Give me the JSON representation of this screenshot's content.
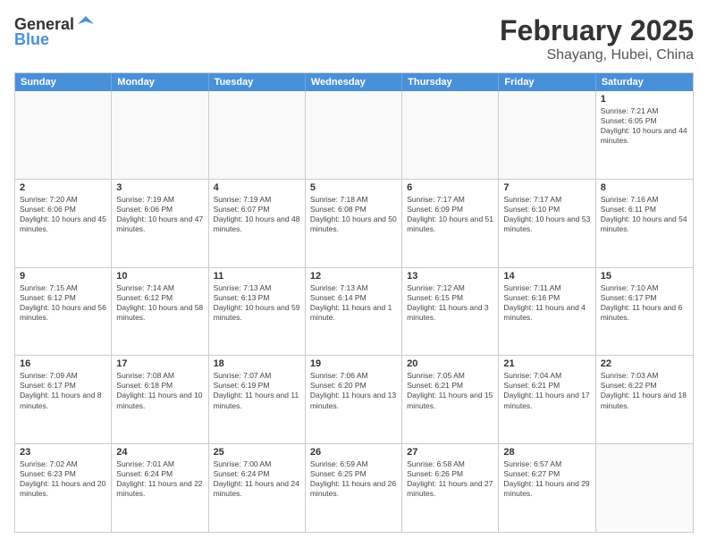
{
  "header": {
    "logo_general": "General",
    "logo_blue": "Blue",
    "month": "February 2025",
    "location": "Shayang, Hubei, China"
  },
  "days_of_week": [
    "Sunday",
    "Monday",
    "Tuesday",
    "Wednesday",
    "Thursday",
    "Friday",
    "Saturday"
  ],
  "weeks": [
    [
      {
        "day": "",
        "empty": true
      },
      {
        "day": "",
        "empty": true
      },
      {
        "day": "",
        "empty": true
      },
      {
        "day": "",
        "empty": true
      },
      {
        "day": "",
        "empty": true
      },
      {
        "day": "",
        "empty": true
      },
      {
        "day": "1",
        "sunrise": "Sunrise: 7:21 AM",
        "sunset": "Sunset: 6:05 PM",
        "daylight": "Daylight: 10 hours and 44 minutes."
      }
    ],
    [
      {
        "day": "2",
        "sunrise": "Sunrise: 7:20 AM",
        "sunset": "Sunset: 6:06 PM",
        "daylight": "Daylight: 10 hours and 45 minutes."
      },
      {
        "day": "3",
        "sunrise": "Sunrise: 7:19 AM",
        "sunset": "Sunset: 6:06 PM",
        "daylight": "Daylight: 10 hours and 47 minutes."
      },
      {
        "day": "4",
        "sunrise": "Sunrise: 7:19 AM",
        "sunset": "Sunset: 6:07 PM",
        "daylight": "Daylight: 10 hours and 48 minutes."
      },
      {
        "day": "5",
        "sunrise": "Sunrise: 7:18 AM",
        "sunset": "Sunset: 6:08 PM",
        "daylight": "Daylight: 10 hours and 50 minutes."
      },
      {
        "day": "6",
        "sunrise": "Sunrise: 7:17 AM",
        "sunset": "Sunset: 6:09 PM",
        "daylight": "Daylight: 10 hours and 51 minutes."
      },
      {
        "day": "7",
        "sunrise": "Sunrise: 7:17 AM",
        "sunset": "Sunset: 6:10 PM",
        "daylight": "Daylight: 10 hours and 53 minutes."
      },
      {
        "day": "8",
        "sunrise": "Sunrise: 7:16 AM",
        "sunset": "Sunset: 6:11 PM",
        "daylight": "Daylight: 10 hours and 54 minutes."
      }
    ],
    [
      {
        "day": "9",
        "sunrise": "Sunrise: 7:15 AM",
        "sunset": "Sunset: 6:12 PM",
        "daylight": "Daylight: 10 hours and 56 minutes."
      },
      {
        "day": "10",
        "sunrise": "Sunrise: 7:14 AM",
        "sunset": "Sunset: 6:12 PM",
        "daylight": "Daylight: 10 hours and 58 minutes."
      },
      {
        "day": "11",
        "sunrise": "Sunrise: 7:13 AM",
        "sunset": "Sunset: 6:13 PM",
        "daylight": "Daylight: 10 hours and 59 minutes."
      },
      {
        "day": "12",
        "sunrise": "Sunrise: 7:13 AM",
        "sunset": "Sunset: 6:14 PM",
        "daylight": "Daylight: 11 hours and 1 minute."
      },
      {
        "day": "13",
        "sunrise": "Sunrise: 7:12 AM",
        "sunset": "Sunset: 6:15 PM",
        "daylight": "Daylight: 11 hours and 3 minutes."
      },
      {
        "day": "14",
        "sunrise": "Sunrise: 7:11 AM",
        "sunset": "Sunset: 6:16 PM",
        "daylight": "Daylight: 11 hours and 4 minutes."
      },
      {
        "day": "15",
        "sunrise": "Sunrise: 7:10 AM",
        "sunset": "Sunset: 6:17 PM",
        "daylight": "Daylight: 11 hours and 6 minutes."
      }
    ],
    [
      {
        "day": "16",
        "sunrise": "Sunrise: 7:09 AM",
        "sunset": "Sunset: 6:17 PM",
        "daylight": "Daylight: 11 hours and 8 minutes."
      },
      {
        "day": "17",
        "sunrise": "Sunrise: 7:08 AM",
        "sunset": "Sunset: 6:18 PM",
        "daylight": "Daylight: 11 hours and 10 minutes."
      },
      {
        "day": "18",
        "sunrise": "Sunrise: 7:07 AM",
        "sunset": "Sunset: 6:19 PM",
        "daylight": "Daylight: 11 hours and 11 minutes."
      },
      {
        "day": "19",
        "sunrise": "Sunrise: 7:06 AM",
        "sunset": "Sunset: 6:20 PM",
        "daylight": "Daylight: 11 hours and 13 minutes."
      },
      {
        "day": "20",
        "sunrise": "Sunrise: 7:05 AM",
        "sunset": "Sunset: 6:21 PM",
        "daylight": "Daylight: 11 hours and 15 minutes."
      },
      {
        "day": "21",
        "sunrise": "Sunrise: 7:04 AM",
        "sunset": "Sunset: 6:21 PM",
        "daylight": "Daylight: 11 hours and 17 minutes."
      },
      {
        "day": "22",
        "sunrise": "Sunrise: 7:03 AM",
        "sunset": "Sunset: 6:22 PM",
        "daylight": "Daylight: 11 hours and 18 minutes."
      }
    ],
    [
      {
        "day": "23",
        "sunrise": "Sunrise: 7:02 AM",
        "sunset": "Sunset: 6:23 PM",
        "daylight": "Daylight: 11 hours and 20 minutes."
      },
      {
        "day": "24",
        "sunrise": "Sunrise: 7:01 AM",
        "sunset": "Sunset: 6:24 PM",
        "daylight": "Daylight: 11 hours and 22 minutes."
      },
      {
        "day": "25",
        "sunrise": "Sunrise: 7:00 AM",
        "sunset": "Sunset: 6:24 PM",
        "daylight": "Daylight: 11 hours and 24 minutes."
      },
      {
        "day": "26",
        "sunrise": "Sunrise: 6:59 AM",
        "sunset": "Sunset: 6:25 PM",
        "daylight": "Daylight: 11 hours and 26 minutes."
      },
      {
        "day": "27",
        "sunrise": "Sunrise: 6:58 AM",
        "sunset": "Sunset: 6:26 PM",
        "daylight": "Daylight: 11 hours and 27 minutes."
      },
      {
        "day": "28",
        "sunrise": "Sunrise: 6:57 AM",
        "sunset": "Sunset: 6:27 PM",
        "daylight": "Daylight: 11 hours and 29 minutes."
      },
      {
        "day": "",
        "empty": true
      }
    ]
  ]
}
